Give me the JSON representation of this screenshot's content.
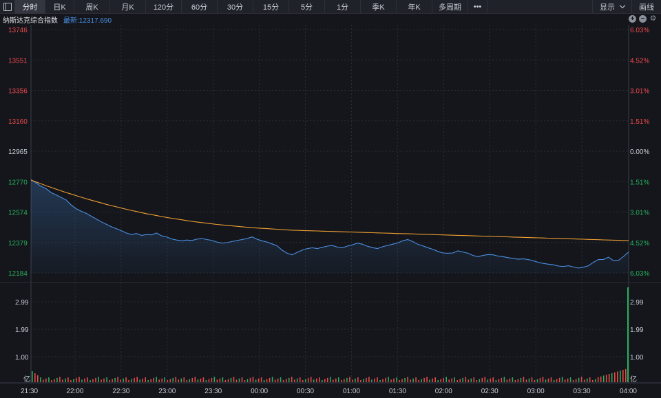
{
  "toolbar": {
    "tabs": [
      {
        "label": "分时",
        "width": 44,
        "active": true
      },
      {
        "label": "日K",
        "width": 42
      },
      {
        "label": "周K",
        "width": 52
      },
      {
        "label": "月K",
        "width": 52
      },
      {
        "label": "120分",
        "width": 52
      },
      {
        "label": "60分",
        "width": 52
      },
      {
        "label": "30分",
        "width": 52
      },
      {
        "label": "15分",
        "width": 52
      },
      {
        "label": "5分",
        "width": 52
      },
      {
        "label": "1分",
        "width": 52
      },
      {
        "label": "季K",
        "width": 52
      },
      {
        "label": "年K",
        "width": 52
      },
      {
        "label": "多周期",
        "width": 52
      }
    ],
    "more_label": "•••",
    "display_label": "显示",
    "draw_label": "画线"
  },
  "info": {
    "name": "纳斯达克综合指数",
    "latest": "最新:12317.690",
    "zoom_in": "+",
    "zoom_out": "−",
    "settings_glyph": "⚙"
  },
  "colors": {
    "up": "#e94a4a",
    "down": "#27b05a",
    "neutral": "#c8ccd4",
    "price_line": "#4a90e2",
    "avg_line": "#f0a030",
    "grid": "#2a2e37"
  },
  "chart_data": {
    "type": "line",
    "price_axis": {
      "left_labels": [
        "13746",
        "13551",
        "13356",
        "13160",
        "12965",
        "12770",
        "12574",
        "12379",
        "12184"
      ],
      "right_labels": [
        "6.03%",
        "4.52%",
        "3.01%",
        "1.51%",
        "0.00%",
        "1.51%",
        "3.01%",
        "4.52%",
        "6.03%"
      ],
      "min": 12184,
      "max": 13746,
      "prev_close": 12965
    },
    "volume_axis": {
      "labels": [
        "2.99",
        "1.99",
        "1.00"
      ],
      "unit": "亿",
      "max": 3.5
    },
    "x_labels": [
      "21:30",
      "22:00",
      "22:30",
      "23:00",
      "23:30",
      "00:00",
      "00:30",
      "01:00",
      "01:30",
      "02:00",
      "02:30",
      "03:00",
      "03:30",
      "04:00"
    ],
    "series": [
      {
        "key": "price",
        "values": [
          12782,
          12762,
          12740,
          12725,
          12700,
          12685,
          12668,
          12652,
          12620,
          12596,
          12580,
          12566,
          12548,
          12530,
          12512,
          12496,
          12480,
          12468,
          12455,
          12440,
          12430,
          12437,
          12425,
          12430,
          12428,
          12440,
          12422,
          12415,
          12402,
          12395,
          12390,
          12395,
          12392,
          12400,
          12405,
          12398,
          12393,
          12382,
          12375,
          12378,
          12385,
          12392,
          12398,
          12404,
          12415,
          12400,
          12390,
          12382,
          12370,
          12358,
          12330,
          12310,
          12300,
          12316,
          12330,
          12340,
          12345,
          12340,
          12348,
          12356,
          12360,
          12350,
          12345,
          12356,
          12364,
          12375,
          12368,
          12355,
          12346,
          12340,
          12352,
          12360,
          12368,
          12376,
          12390,
          12398,
          12385,
          12368,
          12358,
          12346,
          12336,
          12322,
          12312,
          12310,
          12312,
          12325,
          12318,
          12310,
          12296,
          12288,
          12296,
          12302,
          12300,
          12292,
          12288,
          12282,
          12276,
          12272,
          12274,
          12270,
          12262,
          12252,
          12245,
          12240,
          12236,
          12228,
          12225,
          12230,
          12222,
          12215,
          12220,
          12230,
          12252,
          12270,
          12270,
          12285,
          12262,
          12265,
          12290,
          12318
        ]
      },
      {
        "key": "avg",
        "values": [
          12780,
          12768,
          12756,
          12744,
          12733,
          12722,
          12711,
          12700,
          12690,
          12680,
          12670,
          12660,
          12651,
          12642,
          12633,
          12624,
          12616,
          12608,
          12600,
          12592,
          12585,
          12578,
          12571,
          12564,
          12558,
          12552,
          12546,
          12540,
          12535,
          12530,
          12525,
          12520,
          12515,
          12511,
          12507,
          12503,
          12499,
          12495,
          12492,
          12489,
          12486,
          12483,
          12480,
          12477,
          12474,
          12472,
          12470,
          12468,
          12466,
          12464,
          12462,
          12460,
          12458,
          12457,
          12456,
          12455,
          12454,
          12453,
          12452,
          12451,
          12450,
          12449,
          12448,
          12447,
          12446,
          12445,
          12444,
          12443,
          12442,
          12441,
          12440,
          12439,
          12438,
          12437,
          12436,
          12435,
          12434,
          12433,
          12432,
          12431,
          12430,
          12429,
          12428,
          12427,
          12426,
          12425,
          12424,
          12423,
          12422,
          12421,
          12420,
          12419,
          12418,
          12417,
          12416,
          12415,
          12414,
          12413,
          12412,
          12411,
          12410,
          12409,
          12408,
          12407,
          12406,
          12405,
          12404,
          12403,
          12402,
          12401,
          12400,
          12399,
          12398,
          12397,
          12396,
          12395,
          12394,
          12393,
          12392,
          12391
        ]
      }
    ]
  }
}
